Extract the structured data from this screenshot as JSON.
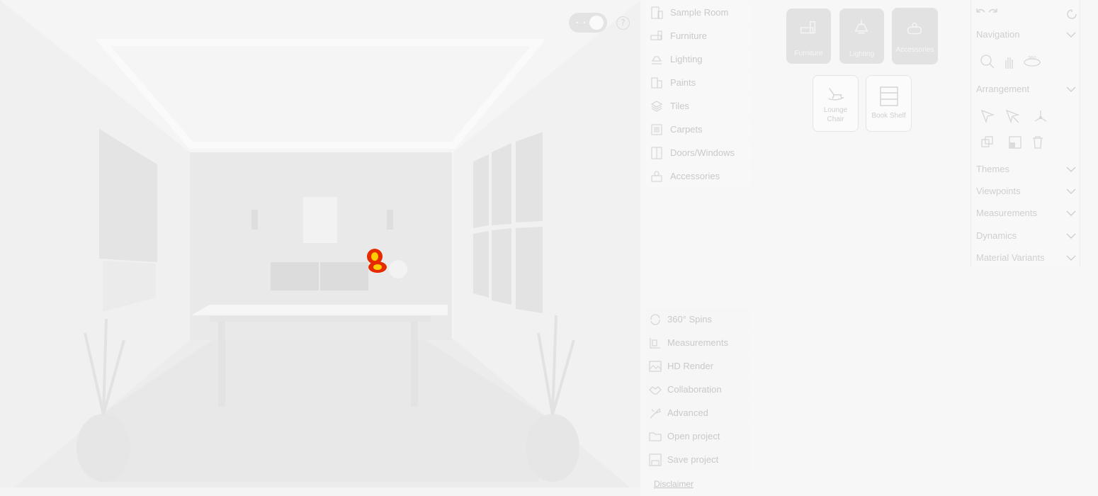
{
  "viewport": {
    "theme_toggle_icon": "moon-icon",
    "help_icon": "question-icon",
    "help_glyph": "?"
  },
  "categories": [
    {
      "label": "Sample Room",
      "icon": "sample-room-icon"
    },
    {
      "label": "Furniture",
      "icon": "furniture-icon"
    },
    {
      "label": "Lighting",
      "icon": "lighting-icon"
    },
    {
      "label": "Paints",
      "icon": "paints-icon"
    },
    {
      "label": "Tiles",
      "icon": "tiles-icon"
    },
    {
      "label": "Carpets",
      "icon": "carpets-icon"
    },
    {
      "label": "Doors/Windows",
      "icon": "doors-windows-icon"
    },
    {
      "label": "Accessories",
      "icon": "accessories-icon"
    }
  ],
  "tiles": {
    "top": [
      {
        "label": "Furniture",
        "icon": "furniture-icon"
      },
      {
        "label": "Lighting",
        "icon": "lamp-icon"
      },
      {
        "label": "Accessories",
        "icon": "accessories-icon"
      }
    ],
    "items": [
      {
        "label": "Lounge Chair",
        "icon": "rocking-chair-icon"
      },
      {
        "label": "Book Shelf",
        "icon": "bookshelf-icon"
      }
    ]
  },
  "tools": [
    {
      "label": "360° Spins",
      "icon": "spin-icon"
    },
    {
      "label": "Measurements",
      "icon": "ruler-icon"
    },
    {
      "label": "HD Render",
      "icon": "image-icon"
    },
    {
      "label": "Collaboration",
      "icon": "collaboration-icon"
    },
    {
      "label": "Advanced",
      "icon": "advanced-icon"
    },
    {
      "label": "Open project",
      "icon": "folder-icon"
    },
    {
      "label": "Save project",
      "icon": "save-icon"
    }
  ],
  "disclaimer": "Disclaimer",
  "panel": {
    "sections": [
      {
        "title": "Navigation"
      },
      {
        "title": "Arrangement"
      },
      {
        "title": "Themes"
      },
      {
        "title": "Viewpoints"
      },
      {
        "title": "Measurements"
      },
      {
        "title": "Dynamics"
      },
      {
        "title": "Material Variants"
      }
    ],
    "nav_360_label": "360"
  },
  "colors": {
    "cursor": "#e52a00",
    "cursor_accent": "#ffcc00"
  }
}
